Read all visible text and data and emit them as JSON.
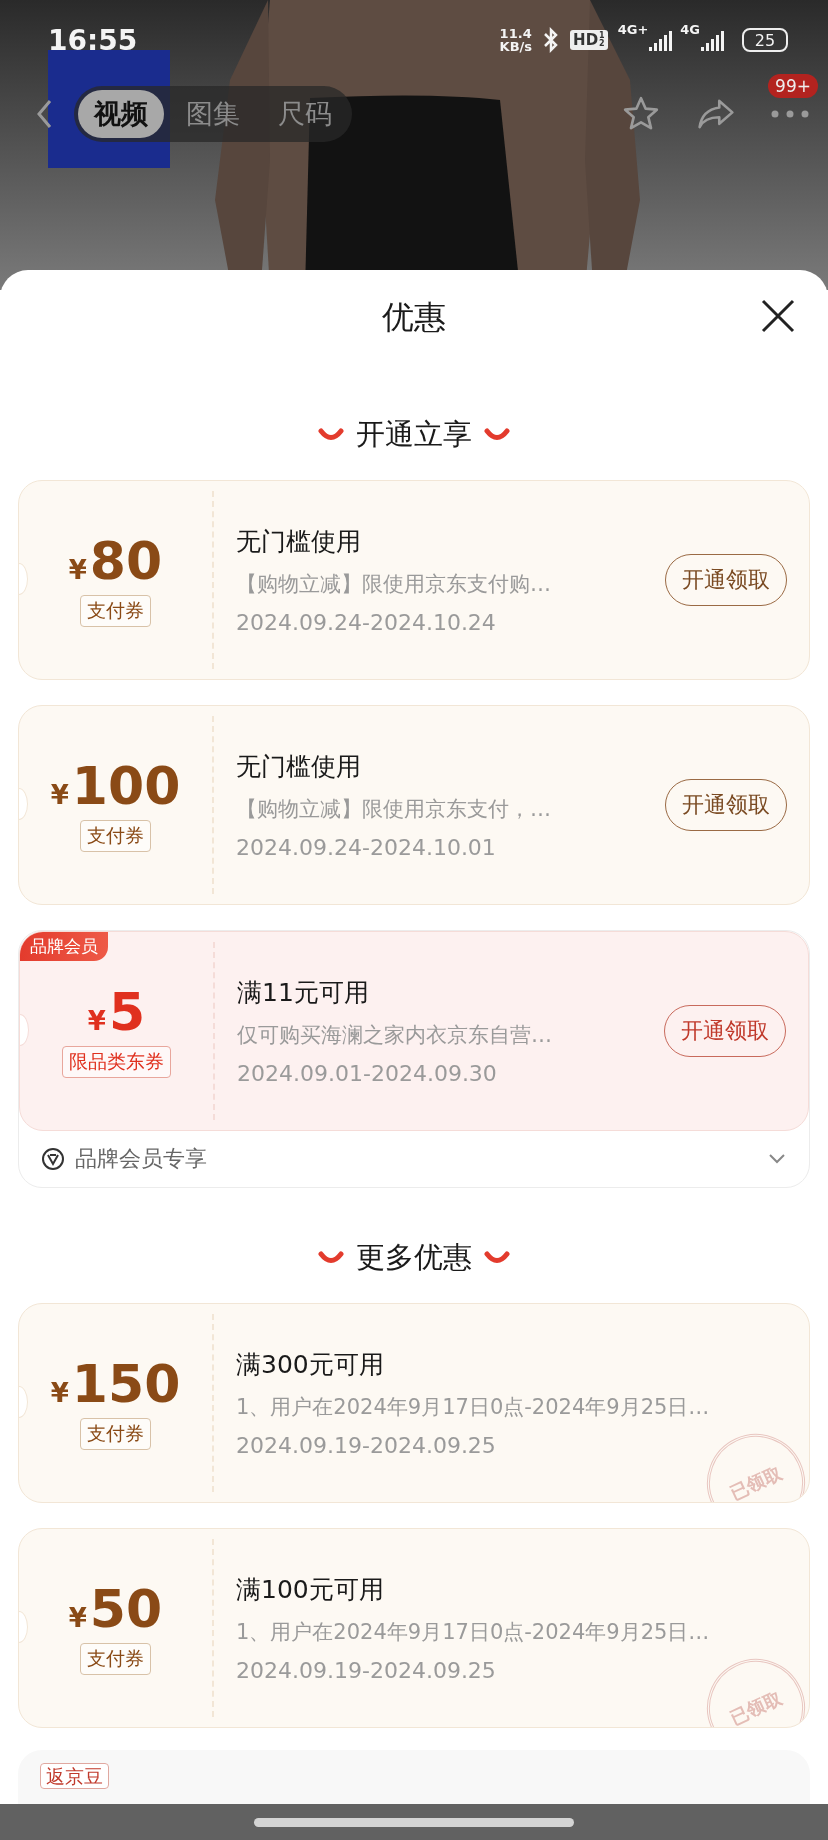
{
  "status_bar": {
    "time": "16:55",
    "net_speed": "11.4",
    "net_unit": "KB/s",
    "hd": "HD",
    "hd_sub": [
      "1",
      "2"
    ],
    "sims": [
      "4G+",
      "4G"
    ],
    "battery": "25"
  },
  "nav": {
    "tabs": [
      {
        "label": "视频",
        "selected": true
      },
      {
        "label": "图集",
        "selected": false
      },
      {
        "label": "尺码",
        "selected": false
      }
    ],
    "badge": "99+"
  },
  "sheet": {
    "title": "优惠"
  },
  "sections": [
    {
      "heading": "开通立享",
      "items": [
        {
          "kind": "coupon",
          "coupon": {
            "kind": "pay",
            "currency": "¥",
            "amount": "80",
            "tag": "支付券",
            "title": "无门槛使用",
            "desc": "【购物立减】限使用京东支付购…",
            "date": "2024.09.24-2024.10.24",
            "button": "开通领取"
          }
        },
        {
          "kind": "coupon",
          "coupon": {
            "kind": "pay",
            "currency": "¥",
            "amount": "100",
            "tag": "支付券",
            "title": "无门槛使用",
            "desc": "【购物立减】限使用京东支付，…",
            "date": "2024.09.24-2024.10.01",
            "button": "开通领取"
          }
        },
        {
          "kind": "member_group",
          "footer": "品牌会员专享",
          "coupon": {
            "kind": "member",
            "brand_tag": "品牌会员",
            "currency": "¥",
            "amount": "5",
            "tag": "限品类东券",
            "title": "满11元可用",
            "desc": "仅可购买海澜之家内衣京东自营…",
            "date": "2024.09.01-2024.09.30",
            "button": "开通领取"
          }
        }
      ]
    },
    {
      "heading": "更多优惠",
      "items": [
        {
          "kind": "coupon",
          "coupon": {
            "kind": "pay",
            "currency": "¥",
            "amount": "150",
            "tag": "支付券",
            "title": "满300元可用",
            "desc": "1、用户在2024年9月17日0点-2024年9月25日…",
            "date": "2024.09.19-2024.09.25",
            "stamp": "已领取"
          }
        },
        {
          "kind": "coupon",
          "coupon": {
            "kind": "pay",
            "currency": "¥",
            "amount": "50",
            "tag": "支付券",
            "title": "满100元可用",
            "desc": "1、用户在2024年9月17日0点-2024年9月25日…",
            "date": "2024.09.19-2024.09.25",
            "stamp": "已领取"
          }
        }
      ]
    }
  ],
  "partial_card": {
    "tag": "返京豆"
  }
}
